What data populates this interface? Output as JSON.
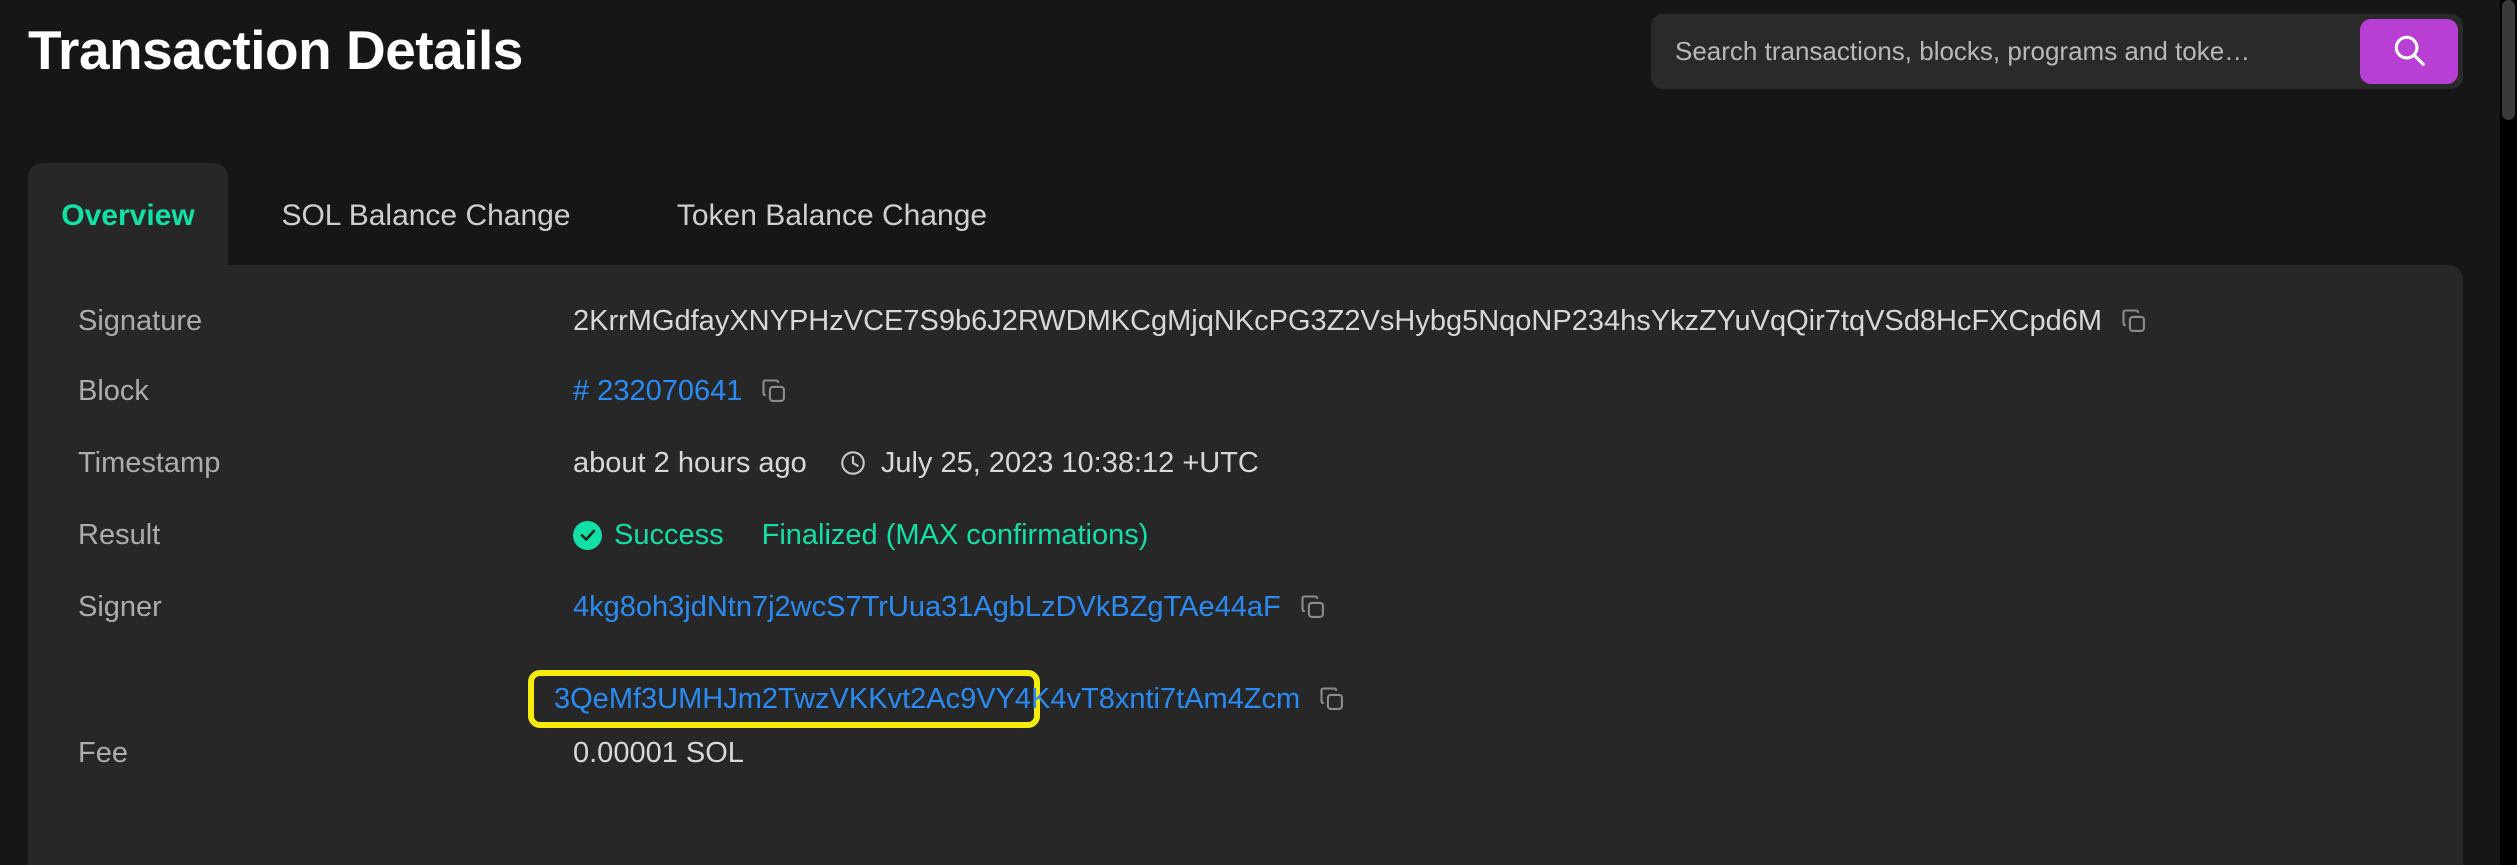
{
  "header": {
    "title": "Transaction Details",
    "search": {
      "placeholder": "Search transactions, blocks, programs and toke…",
      "value": "",
      "button_icon": "search-icon",
      "button_color": "#b83fd4"
    }
  },
  "tabs": [
    {
      "label": "Overview",
      "active": true
    },
    {
      "label": "SOL Balance Change",
      "active": false
    },
    {
      "label": "Token Balance Change",
      "active": false
    }
  ],
  "overview": {
    "signature": {
      "label": "Signature",
      "value": "2KrrMGdfayXNYPHzVCE7S9b6J2RWDMKCgMjqNKcPG3Z2VsHybg5NqoNP234hsYkzZYuVqQir7tqVSd8HcFXCpd6M",
      "copy_icon": "copy-icon"
    },
    "block": {
      "label": "Block",
      "value": "# 232070641",
      "copy_icon": "copy-icon",
      "color": "#2a8bf2"
    },
    "timestamp": {
      "label": "Timestamp",
      "relative": "about 2 hours ago",
      "clock_icon": "clock-icon",
      "absolute": "July 25, 2023 10:38:12 +UTC"
    },
    "result": {
      "label": "Result",
      "status_icon": "check-circle-icon",
      "status": "Success",
      "confirmations": "Finalized (MAX confirmations)",
      "color": "#12e0a4"
    },
    "signer": {
      "label": "Signer",
      "addresses": [
        {
          "value": "4kg8oh3jdNtn7j2wcS7TrUua31AgbLzDVkBZgTAe44aF",
          "copy_icon": "copy-icon",
          "highlighted": false
        },
        {
          "value": "3QeMf3UMHJm2TwzVKKvt2Ac9VY4K4vT8xnti7tAm4Zcm",
          "copy_icon": "copy-icon",
          "highlighted": true,
          "highlight_color": "#f5ec0b"
        }
      ]
    },
    "fee": {
      "label": "Fee",
      "value": "0.00001 SOL"
    }
  }
}
